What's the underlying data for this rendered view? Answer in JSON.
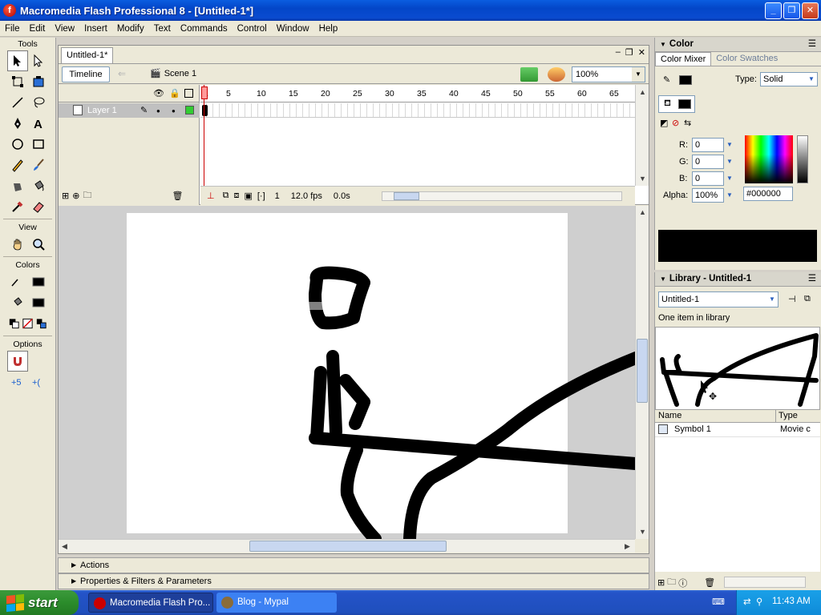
{
  "window": {
    "title": "Macromedia Flash Professional 8 - [Untitled-1*]",
    "app_icon_letter": "f"
  },
  "menu": [
    "File",
    "Edit",
    "View",
    "Insert",
    "Modify",
    "Text",
    "Commands",
    "Control",
    "Window",
    "Help"
  ],
  "tools": {
    "title": "Tools",
    "view_label": "View",
    "colors_label": "Colors",
    "options_label": "Options",
    "selected": "selection-tool"
  },
  "document": {
    "tab": "Untitled-1*",
    "timeline_button": "Timeline",
    "scene": "Scene 1",
    "zoom": "100%",
    "layer_name": "Layer 1",
    "frame_numbers": [
      "1",
      "5",
      "10",
      "15",
      "20",
      "25",
      "30",
      "35",
      "40",
      "45",
      "50",
      "55",
      "60",
      "65"
    ],
    "status": {
      "current_frame": "1",
      "fps": "12.0 fps",
      "time": "0.0s"
    }
  },
  "collapsed_panels": {
    "actions": "Actions",
    "properties": "Properties & Filters & Parameters"
  },
  "color_panel": {
    "title": "Color",
    "tab_mixer": "Color Mixer",
    "tab_swatches": "Color Swatches",
    "type_label": "Type:",
    "type_value": "Solid",
    "r_label": "R:",
    "r_value": "0",
    "g_label": "G:",
    "g_value": "0",
    "b_label": "B:",
    "b_value": "0",
    "alpha_label": "Alpha:",
    "alpha_value": "100%",
    "hex_value": "#000000",
    "current_color": "#000000"
  },
  "library_panel": {
    "title": "Library - Untitled-1",
    "document_select": "Untitled-1",
    "info": "One item in library",
    "col_name": "Name",
    "col_type": "Type",
    "items": [
      {
        "name": "Symbol 1",
        "type": "Movie c"
      }
    ]
  },
  "taskbar": {
    "start": "start",
    "items": [
      "Macromedia Flash Pro...",
      "Blog - Mypal"
    ],
    "clock": "11:43 AM"
  }
}
